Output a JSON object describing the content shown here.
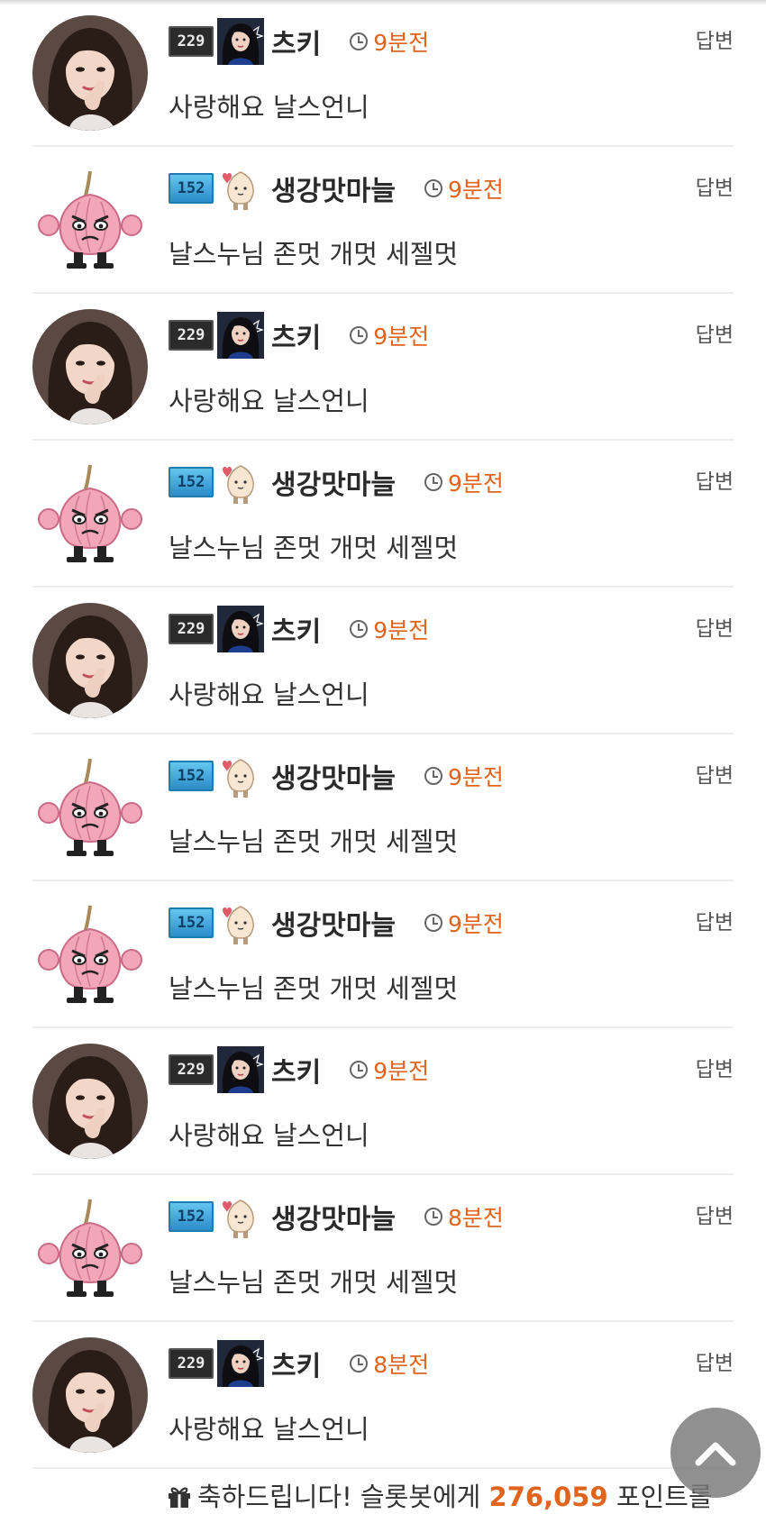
{
  "colors": {
    "time": "#e0641e",
    "points": "#e0641e",
    "divider": "#ececec"
  },
  "comments": [
    {
      "user": "chuki",
      "nickname": "츠키",
      "level": "229",
      "time": "9분전",
      "reply_label": "답변",
      "text": "사랑해요 날스언니"
    },
    {
      "user": "garlic",
      "nickname": "생강맛마늘",
      "level": "152",
      "time": "9분전",
      "reply_label": "답변",
      "text": "날스누님 존멋 개멋 세젤멋"
    },
    {
      "user": "chuki",
      "nickname": "츠키",
      "level": "229",
      "time": "9분전",
      "reply_label": "답변",
      "text": "사랑해요 날스언니"
    },
    {
      "user": "garlic",
      "nickname": "생강맛마늘",
      "level": "152",
      "time": "9분전",
      "reply_label": "답변",
      "text": "날스누님 존멋 개멋 세젤멋"
    },
    {
      "user": "chuki",
      "nickname": "츠키",
      "level": "229",
      "time": "9분전",
      "reply_label": "답변",
      "text": "사랑해요 날스언니"
    },
    {
      "user": "garlic",
      "nickname": "생강맛마늘",
      "level": "152",
      "time": "9분전",
      "reply_label": "답변",
      "text": "날스누님 존멋 개멋 세젤멋"
    },
    {
      "user": "garlic",
      "nickname": "생강맛마늘",
      "level": "152",
      "time": "9분전",
      "reply_label": "답변",
      "text": "날스누님 존멋 개멋 세젤멋"
    },
    {
      "user": "chuki",
      "nickname": "츠키",
      "level": "229",
      "time": "9분전",
      "reply_label": "답변",
      "text": "사랑해요 날스언니"
    },
    {
      "user": "garlic",
      "nickname": "생강맛마늘",
      "level": "152",
      "time": "8분전",
      "reply_label": "답변",
      "text": "날스누님 존멋 개멋 세젤멋"
    },
    {
      "user": "chuki",
      "nickname": "츠키",
      "level": "229",
      "time": "8분전",
      "reply_label": "답변",
      "text": "사랑해요 날스언니"
    }
  ],
  "notice": {
    "icon": "gift-icon",
    "prefix": "축하드립니다! 슬롯봇에게 ",
    "points": "276,059",
    "suffix": " 포인트를"
  },
  "scroll_top": {
    "icon": "chevron-up-icon"
  }
}
